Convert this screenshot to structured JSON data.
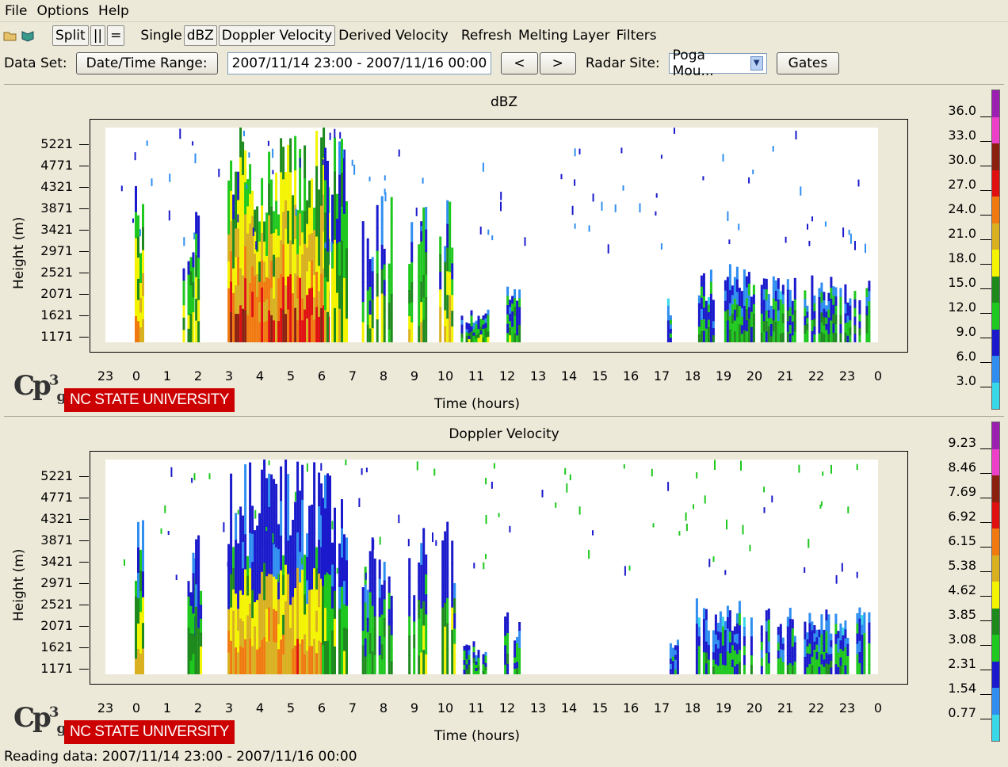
{
  "menu": [
    "File",
    "Options",
    "Help"
  ],
  "toolbar": {
    "split": "Split",
    "parallel": "||",
    "equal": "=",
    "single": "Single",
    "dbz": "dBZ",
    "doppler": "Doppler Velocity",
    "derived": "Derived Velocity",
    "refresh": "Refresh",
    "melting": "Melting Layer",
    "filters": "Filters"
  },
  "dataset": {
    "label": "Data Set:",
    "range_button": "Date/Time Range:",
    "range_value": "2007/11/14 23:00 - 2007/11/16 00:00",
    "prev": "<",
    "next": ">",
    "radar_label": "Radar Site:",
    "radar_value": "Poga Mou...",
    "gates": "Gates"
  },
  "panels": [
    {
      "title": "dBZ",
      "ylabel": "Height (m)",
      "xlabel": "Time (hours)",
      "colorbar": [
        "36.0",
        "33.0",
        "30.0",
        "27.0",
        "24.0",
        "21.0",
        "18.0",
        "15.0",
        "12.0",
        "9.0",
        "6.0",
        "3.0"
      ]
    },
    {
      "title": "Doppler Velocity",
      "ylabel": "Height (m)",
      "xlabel": "Time (hours)",
      "colorbar": [
        "9.23",
        "8.46",
        "7.69",
        "6.92",
        "6.15",
        "5.38",
        "4.62",
        "3.85",
        "3.08",
        "2.31",
        "1.54",
        "0.77"
      ]
    }
  ],
  "yticks": [
    "5221",
    "4771",
    "4321",
    "3871",
    "3421",
    "2971",
    "2521",
    "2071",
    "1621",
    "1171"
  ],
  "xticks": [
    "23",
    "0",
    "1",
    "2",
    "3",
    "4",
    "5",
    "6",
    "7",
    "8",
    "9",
    "10",
    "11",
    "12",
    "13",
    "14",
    "15",
    "16",
    "17",
    "18",
    "19",
    "20",
    "21",
    "22",
    "23",
    "0"
  ],
  "colorbar_colors": [
    "#9b1fb0",
    "#ee3fc8",
    "#8b2010",
    "#e01010",
    "#f07a10",
    "#d8b020",
    "#f4f400",
    "#1e8a1e",
    "#1ec81e",
    "#1a1acc",
    "#2f8ef0",
    "#38d8e8"
  ],
  "logo": {
    "cp": "Cp",
    "sup": "3",
    "sub": "g",
    "ncsu": "NC STATE UNIVERSITY"
  },
  "status": "Reading data: 2007/11/14 23:00 - 2007/11/16 00:00",
  "chart_data": [
    {
      "type": "heatmap",
      "title": "dBZ",
      "xlabel": "Time (hours)",
      "ylabel": "Height (m)",
      "x": [
        "23",
        "0",
        "1",
        "2",
        "3",
        "4",
        "5",
        "6",
        "7",
        "8",
        "9",
        "10",
        "11",
        "12",
        "13",
        "14",
        "15",
        "16",
        "17",
        "18",
        "19",
        "20",
        "21",
        "22",
        "23",
        "0"
      ],
      "y": [
        1171,
        1621,
        2071,
        2521,
        2971,
        3421,
        3871,
        4321,
        4771,
        5221
      ],
      "colorbar": [
        3.0,
        6.0,
        9.0,
        12.0,
        15.0,
        18.0,
        21.0,
        24.0,
        27.0,
        30.0,
        33.0,
        36.0
      ]
    },
    {
      "type": "heatmap",
      "title": "Doppler Velocity",
      "xlabel": "Time (hours)",
      "ylabel": "Height (m)",
      "x": [
        "23",
        "0",
        "1",
        "2",
        "3",
        "4",
        "5",
        "6",
        "7",
        "8",
        "9",
        "10",
        "11",
        "12",
        "13",
        "14",
        "15",
        "16",
        "17",
        "18",
        "19",
        "20",
        "21",
        "22",
        "23",
        "0"
      ],
      "y": [
        1171,
        1621,
        2071,
        2521,
        2971,
        3421,
        3871,
        4321,
        4771,
        5221
      ],
      "colorbar": [
        0.77,
        1.54,
        2.31,
        3.08,
        3.85,
        4.62,
        5.38,
        6.15,
        6.92,
        7.69,
        8.46,
        9.23
      ]
    }
  ]
}
